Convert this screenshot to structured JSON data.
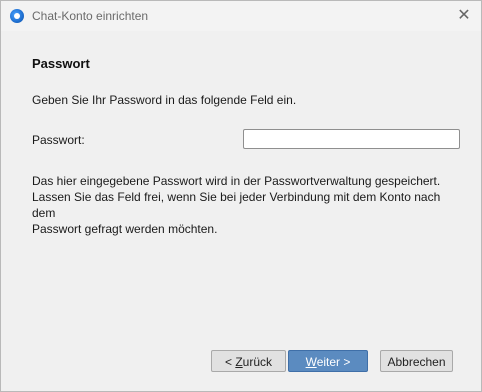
{
  "window": {
    "title": "Chat-Konto einrichten",
    "close_glyph": "✕"
  },
  "page": {
    "heading": "Passwort",
    "instruction": "Geben Sie Ihr Password in das folgende Feld ein.",
    "password_label": "Passwort:",
    "password_value": "",
    "hint_line1": "Das hier eingegebene Passwort wird in der Passwortverwaltung gespeichert.",
    "hint_line2": "Lassen Sie das Feld frei, wenn Sie bei jeder Verbindung mit dem Konto nach dem",
    "hint_line3": "Passwort gefragt werden möchten."
  },
  "buttons": {
    "back_prefix": "< ",
    "back_mnemonic": "Z",
    "back_rest": "urück",
    "next_mnemonic": "W",
    "next_rest": "eiter >",
    "cancel": "Abbrechen"
  },
  "colors": {
    "primary_button": "#5b8bc0",
    "dialog_background": "#f0f0f0"
  },
  "icons": {
    "app": "chat-app-icon",
    "close": "close-icon"
  }
}
